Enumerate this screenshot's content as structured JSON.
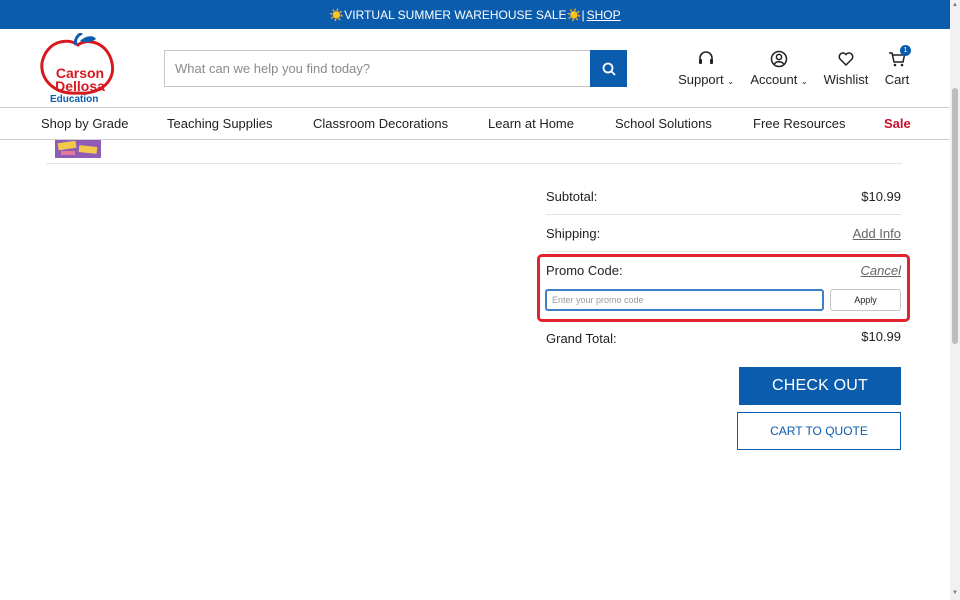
{
  "banner": {
    "text": "☀️VIRTUAL SUMMER WAREHOUSE SALE☀️|",
    "link": "SHOP"
  },
  "logo": {
    "line1": "Carson",
    "line2": "Dellosa",
    "line3": "Education"
  },
  "search": {
    "placeholder": "What can we help you find today?"
  },
  "header": {
    "support": "Support",
    "account": "Account",
    "wishlist": "Wishlist",
    "cart": "Cart",
    "cart_count": "1"
  },
  "nav": {
    "items": [
      "Shop by Grade",
      "Teaching Supplies",
      "Classroom Decorations",
      "Learn at Home",
      "School Solutions",
      "Free Resources",
      "Sale"
    ]
  },
  "summary": {
    "subtotal_label": "Subtotal:",
    "subtotal_value": "$10.99",
    "shipping_label": "Shipping:",
    "shipping_value": "Add Info",
    "promo_label": "Promo Code:",
    "promo_cancel": "Cancel",
    "promo_placeholder": "Enter your promo code",
    "apply": "Apply",
    "grand_total_label": "Grand Total:",
    "grand_total_value": "$10.99"
  },
  "actions": {
    "checkout": "CHECK OUT",
    "cart_to_quote": "CART TO QUOTE"
  },
  "colors": {
    "brand_blue": "#0b5cad",
    "sale_red": "#c8102e",
    "highlight_red": "#e0242c"
  }
}
